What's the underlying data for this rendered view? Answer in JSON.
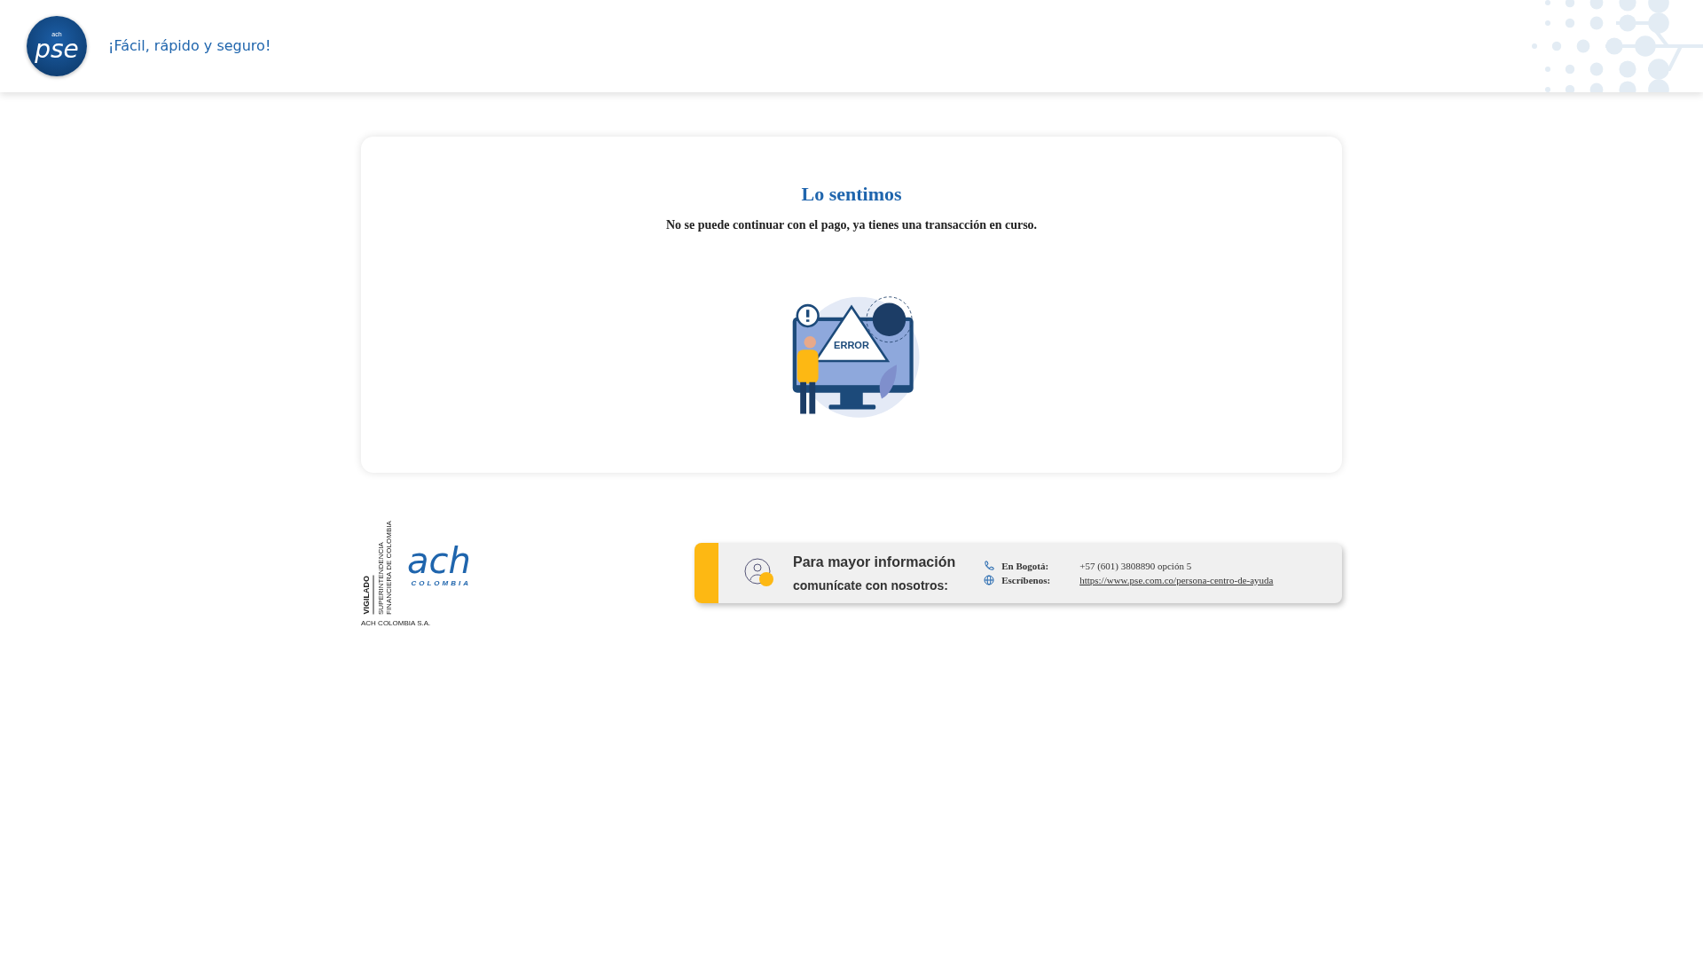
{
  "header": {
    "logo_small": "ach",
    "logo_text": "pse",
    "slogan": "¡Fácil, rápido y seguro!"
  },
  "message": {
    "title": "Lo sentimos",
    "text": "No se puede continuar con el pago, ya tienes una transacción en curso.",
    "illustration_label": "ERROR"
  },
  "footer": {
    "vigilado": "VIGILADO",
    "supervisor": "SUPERINTENDENCIA FINANCIERA DE COLOMBIA",
    "company": "ACH COLOMBIA S.A.",
    "ach_logo": "ach",
    "ach_sub": "COLOMBIA",
    "info": {
      "title": "Para mayor información",
      "subtitle": "comunícate con nosotros:",
      "contacts": [
        {
          "kind": "phone",
          "label": "En Bogotá:",
          "value": "+57 (601) 3808890 opción 5"
        },
        {
          "kind": "web",
          "label": "Escríbenos:",
          "value": "https://www.pse.com.co/persona-centro-de-ayuda"
        }
      ]
    }
  }
}
